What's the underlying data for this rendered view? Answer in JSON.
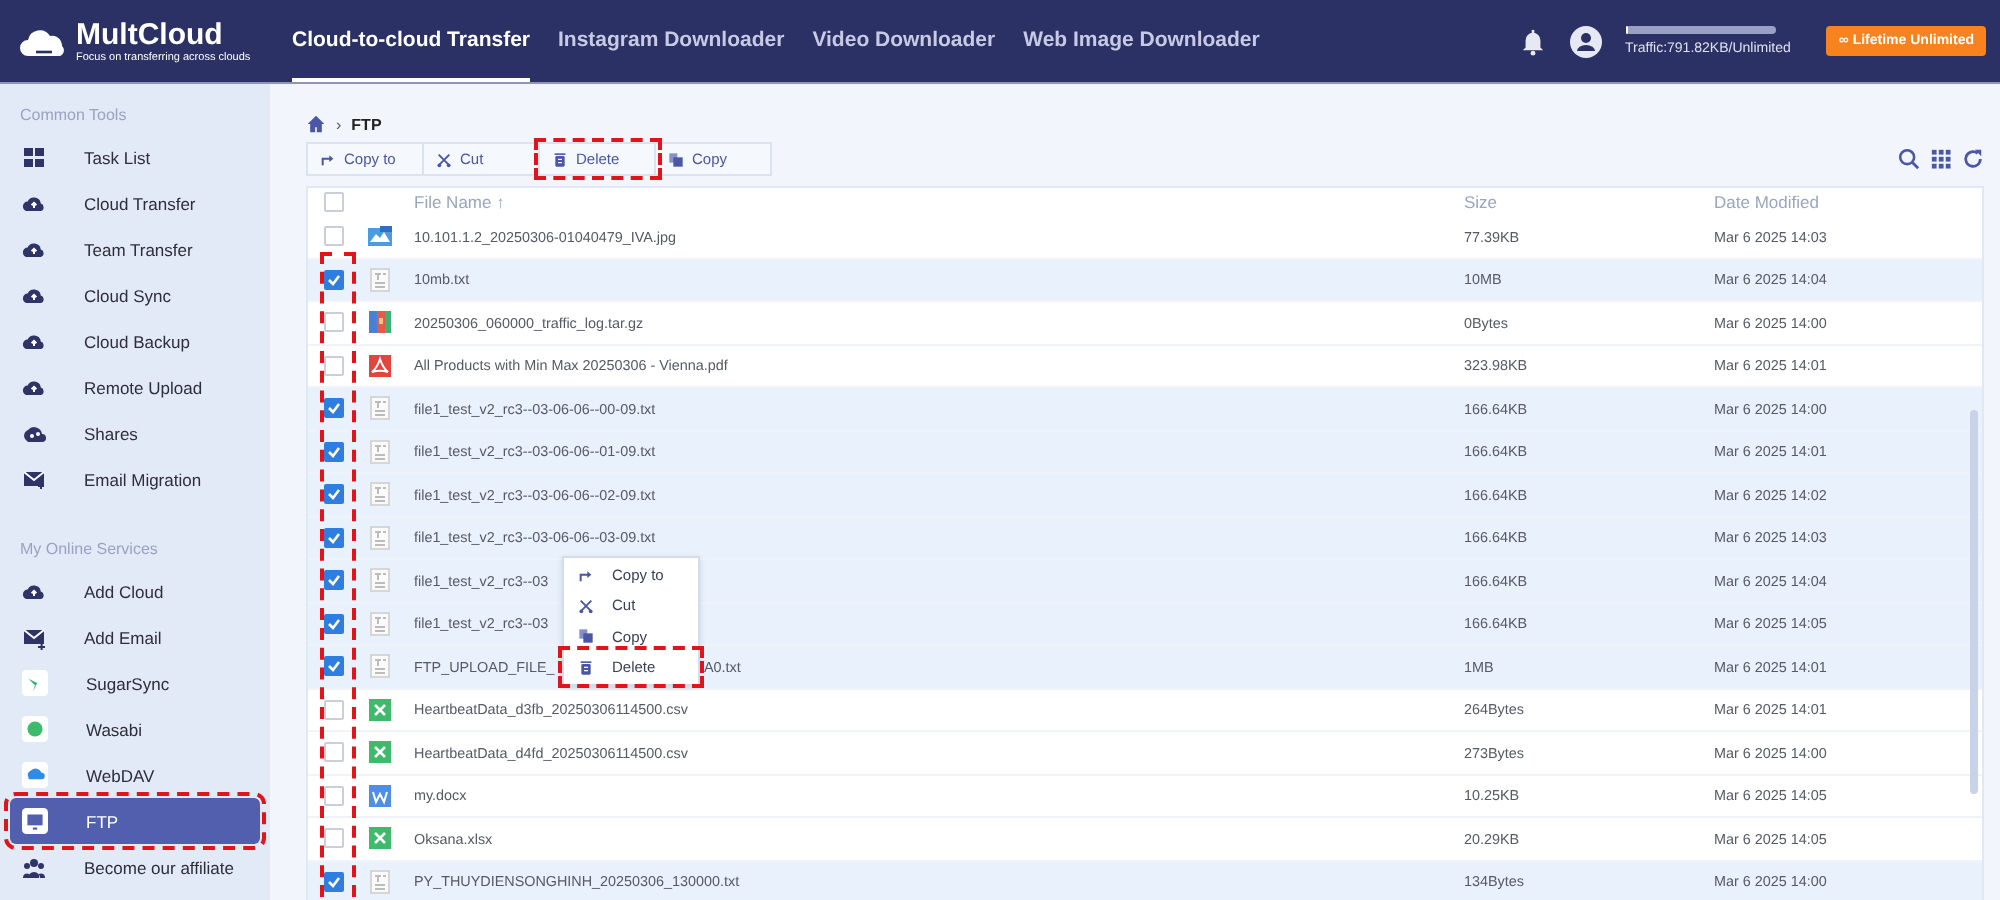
{
  "header": {
    "logo": {
      "name": "MultCloud",
      "tagline": "Focus on transferring across clouds"
    },
    "tabs": [
      {
        "label": "Cloud-to-cloud Transfer",
        "selected": true
      },
      {
        "label": "Instagram Downloader",
        "selected": false
      },
      {
        "label": "Video Downloader",
        "selected": false
      },
      {
        "label": "Web Image Downloader",
        "selected": false
      }
    ],
    "traffic": {
      "text": "Traffic:791.82KB/Unlimited",
      "level": 0.01
    },
    "upgrade_button": "∞ Lifetime Unlimited"
  },
  "sidebar": {
    "sections": [
      {
        "title": "Common Tools",
        "items": [
          {
            "label": "Task List",
            "selected": false,
            "highlighted": false
          },
          {
            "label": "Cloud Transfer",
            "selected": false,
            "highlighted": false
          },
          {
            "label": "Team Transfer",
            "selected": false,
            "highlighted": false
          },
          {
            "label": "Cloud Sync",
            "selected": false,
            "highlighted": false
          },
          {
            "label": "Cloud Backup",
            "selected": false,
            "highlighted": false
          },
          {
            "label": "Remote Upload",
            "selected": false,
            "highlighted": false
          },
          {
            "label": "Shares",
            "selected": false,
            "highlighted": false
          },
          {
            "label": "Email Migration",
            "selected": false,
            "highlighted": false
          }
        ]
      },
      {
        "title": "My Online Services",
        "items": [
          {
            "label": "Add Cloud",
            "selected": false,
            "highlighted": false
          },
          {
            "label": "Add Email",
            "selected": false,
            "highlighted": false
          },
          {
            "label": "SugarSync",
            "selected": false,
            "highlighted": false
          },
          {
            "label": "Wasabi",
            "selected": false,
            "highlighted": false
          },
          {
            "label": "WebDAV",
            "selected": false,
            "highlighted": false
          },
          {
            "label": "FTP",
            "selected": true,
            "highlighted": true
          },
          {
            "label": "Become our affiliate",
            "selected": false,
            "highlighted": false
          }
        ]
      }
    ]
  },
  "breadcrumb": {
    "separator": "›",
    "current": "FTP"
  },
  "toolbar": [
    {
      "label": "Copy to",
      "highlighted": false
    },
    {
      "label": "Cut",
      "highlighted": false
    },
    {
      "label": "Delete",
      "highlighted": true
    },
    {
      "label": "Copy",
      "highlighted": false
    }
  ],
  "table": {
    "columns": [
      "File Name",
      "Size",
      "Date Modified"
    ],
    "sort_indicator": "↑",
    "select_all_checked": false,
    "checkbox_column_highlighted": true,
    "rows": [
      {
        "name": "10.101.1.2_20250306-01040479_IVA.jpg",
        "size": "77.39KB",
        "date": "Mar 6 2025 14:03",
        "kind": "image",
        "checked": false
      },
      {
        "name": "10mb.txt",
        "size": "10MB",
        "date": "Mar 6 2025 14:04",
        "kind": "text",
        "checked": true
      },
      {
        "name": "20250306_060000_traffic_log.tar.gz",
        "size": "0Bytes",
        "date": "Mar 6 2025 14:00",
        "kind": "archive",
        "checked": false
      },
      {
        "name": "All Products with Min Max 20250306 - Vienna.pdf",
        "size": "323.98KB",
        "date": "Mar 6 2025 14:01",
        "kind": "pdf",
        "checked": false
      },
      {
        "name": "file1_test_v2_rc3--03-06-06--00-09.txt",
        "size": "166.64KB",
        "date": "Mar 6 2025 14:00",
        "kind": "text",
        "checked": true
      },
      {
        "name": "file1_test_v2_rc3--03-06-06--01-09.txt",
        "size": "166.64KB",
        "date": "Mar 6 2025 14:01",
        "kind": "text",
        "checked": true
      },
      {
        "name": "file1_test_v2_rc3--03-06-06--02-09.txt",
        "size": "166.64KB",
        "date": "Mar 6 2025 14:02",
        "kind": "text",
        "checked": true
      },
      {
        "name": "file1_test_v2_rc3--03-06-06--03-09.txt",
        "size": "166.64KB",
        "date": "Mar 6 2025 14:03",
        "kind": "text",
        "checked": true
      },
      {
        "name": "file1_test_v2_rc3--03",
        "size": "166.64KB",
        "date": "Mar 6 2025 14:04",
        "kind": "text",
        "checked": true
      },
      {
        "name": "file1_test_v2_rc3--03",
        "size": "166.64KB",
        "date": "Mar 6 2025 14:05",
        "kind": "text",
        "checked": true
      },
      {
        "name": "FTP_UPLOAD_FILE_",
        "name_tail": "A0.txt",
        "size": "1MB",
        "date": "Mar 6 2025 14:01",
        "kind": "text",
        "checked": true
      },
      {
        "name": "HeartbeatData_d3fb_20250306114500.csv",
        "size": "264Bytes",
        "date": "Mar 6 2025 14:01",
        "kind": "sheet",
        "checked": false
      },
      {
        "name": "HeartbeatData_d4fd_20250306114500.csv",
        "size": "273Bytes",
        "date": "Mar 6 2025 14:00",
        "kind": "sheet",
        "checked": false
      },
      {
        "name": "my.docx",
        "size": "10.25KB",
        "date": "Mar 6 2025 14:05",
        "kind": "doc",
        "checked": false
      },
      {
        "name": "Oksana.xlsx",
        "size": "20.29KB",
        "date": "Mar 6 2025 14:05",
        "kind": "sheet",
        "checked": false
      },
      {
        "name": "PY_THUYDIENSONGHINH_20250306_130000.txt",
        "size": "134Bytes",
        "date": "Mar 6 2025 14:00",
        "kind": "text",
        "checked": true
      }
    ]
  },
  "context_menu": [
    {
      "label": "Copy to",
      "highlighted": false
    },
    {
      "label": "Cut",
      "highlighted": false
    },
    {
      "label": "Copy",
      "highlighted": false
    },
    {
      "label": "Delete",
      "highlighted": true
    }
  ]
}
